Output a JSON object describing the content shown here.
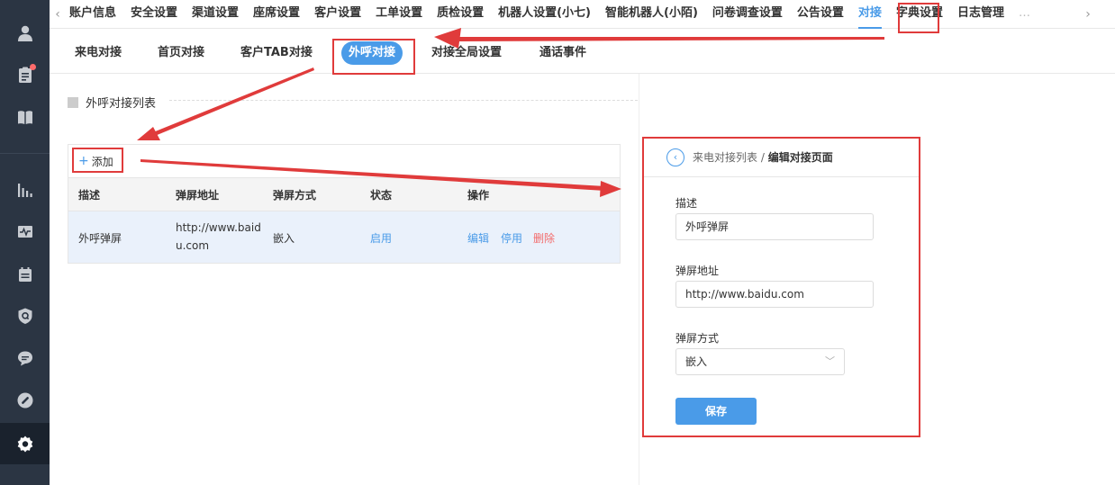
{
  "sidebar": {
    "icons": [
      "user-icon",
      "clipboard-icon",
      "book-icon",
      "bar-chart-icon",
      "monitor-pulse-icon",
      "calendar-icon",
      "shield-q-icon",
      "chat-icon",
      "link-icon",
      "settings-icon"
    ]
  },
  "topnav": {
    "prev_arrow": "‹",
    "next_arrow": "›",
    "items": [
      "账户信息",
      "安全设置",
      "渠道设置",
      "座席设置",
      "客户设置",
      "工单设置",
      "质检设置",
      "机器人设置(小七)",
      "智能机器人(小陌)",
      "问卷调查设置",
      "公告设置",
      "对接",
      "字典设置",
      "日志管理",
      "…"
    ],
    "active": "对接"
  },
  "subtabs": {
    "items": [
      "来电对接",
      "首页对接",
      "客户TAB对接",
      "外呼对接",
      "对接全局设置",
      "通话事件"
    ],
    "active": "外呼对接"
  },
  "section": {
    "title": "外呼对接列表"
  },
  "table": {
    "add_label": "添加",
    "columns": [
      "描述",
      "弹屏地址",
      "弹屏方式",
      "状态",
      "操作"
    ],
    "rows": [
      {
        "desc": "外呼弹屏",
        "url_line1": "http://www.baid",
        "url_line2": "u.com",
        "mode": "嵌入",
        "status": "启用",
        "actions": [
          "编辑",
          "停用",
          "删除"
        ]
      }
    ]
  },
  "edit_panel": {
    "breadcrumb_parent": "来电对接列表",
    "breadcrumb_sep": " / ",
    "breadcrumb_current": "编辑对接页面",
    "fields": {
      "desc_label": "描述",
      "desc_value": "外呼弹屏",
      "url_label": "弹屏地址",
      "url_value": "http://www.baidu.com",
      "mode_label": "弹屏方式",
      "mode_value": "嵌入"
    },
    "save_label": "保存"
  },
  "colors": {
    "accent": "#4a9be8",
    "sidebar": "#2b3543",
    "annotation": "#e03b3b",
    "danger": "#f36b6b"
  }
}
